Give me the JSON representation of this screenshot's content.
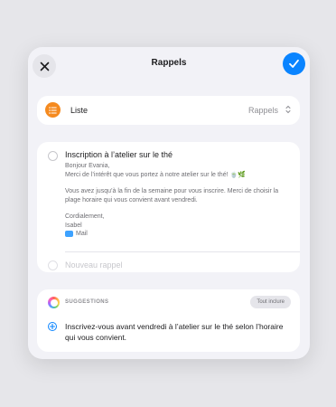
{
  "header": {
    "title": "Rappels",
    "close_icon": "close-icon",
    "done_icon": "checkmark-icon",
    "accent": "#0a84ff"
  },
  "list_row": {
    "label": "Liste",
    "value": "Rappels",
    "icon": "list-bullet-icon",
    "icon_color": "#f58a1f"
  },
  "reminder": {
    "title": "Inscription à l’atelier sur le thé",
    "note_lines": [
      "Bonjour Evania,",
      "Merci de l’intérêt que vous portez à notre atelier sur le thé! 🍵🌿",
      "Vous avez jusqu’à la fin de la semaine pour vous inscrire. Merci de choisir la plage horaire qui vous convient avant vendredi.",
      "Cordialement,",
      "Isabel"
    ],
    "source": "Mail",
    "source_icon": "mail-icon"
  },
  "new_reminder": {
    "placeholder": "Nouveau rappel"
  },
  "suggestions": {
    "heading": "SUGGESTIONS",
    "include_all": "Tout inclure",
    "item_text": "Inscrivez-vous avant vendredi à l’atelier sur le thé selon l’horaire qui vous convient."
  }
}
